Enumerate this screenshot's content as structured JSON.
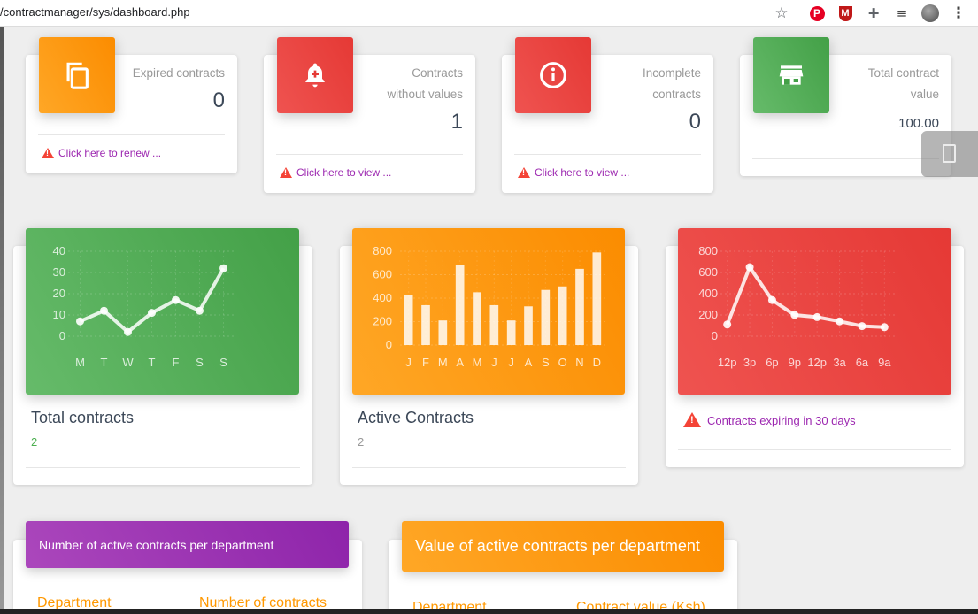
{
  "browser": {
    "url": "/contractmanager/sys/dashboard.php",
    "icons": [
      "star-icon",
      "pinterest-icon",
      "mcafee-icon",
      "extensions-icon",
      "media-queue-icon",
      "profile-avatar",
      "menu-dots-icon"
    ]
  },
  "stats": [
    {
      "label_lines": [
        "Expired contracts"
      ],
      "value": "0",
      "link": "Click here to renew ...",
      "icon": "copy-icon",
      "color": "#fb8c00"
    },
    {
      "label_lines": [
        "Contracts",
        "without values"
      ],
      "value": "1",
      "link": "Click here to view ...",
      "icon": "notification-add-icon",
      "color": "#e53935"
    },
    {
      "label_lines": [
        "Incomplete",
        "contracts"
      ],
      "value": "0",
      "link": "Click here to view ...",
      "icon": "info-icon",
      "color": "#e53935"
    },
    {
      "label_lines": [
        "Total contract",
        "value"
      ],
      "value": "100.00",
      "link": "",
      "icon": "store-icon",
      "color": "#43a047"
    }
  ],
  "charts": {
    "total": {
      "title": "Total contracts",
      "subtitle": "2",
      "chart_data": {
        "type": "line",
        "categories": [
          "M",
          "T",
          "W",
          "T",
          "F",
          "S",
          "S"
        ],
        "values": [
          7,
          12,
          2,
          11,
          17,
          12,
          32
        ],
        "ylim": [
          0,
          40
        ],
        "yticks": [
          0,
          10,
          20,
          30,
          40
        ],
        "color": "#ffffff"
      }
    },
    "active": {
      "title": "Active Contracts",
      "subtitle": "2",
      "chart_data": {
        "type": "bar",
        "categories": [
          "J",
          "F",
          "M",
          "A",
          "M",
          "J",
          "J",
          "A",
          "S",
          "O",
          "N",
          "D"
        ],
        "values": [
          430,
          340,
          210,
          680,
          450,
          340,
          210,
          330,
          470,
          500,
          650,
          790
        ],
        "ylim": [
          0,
          800
        ],
        "yticks": [
          0,
          200,
          400,
          600,
          800
        ],
        "color": "#ffffff"
      }
    },
    "expiring": {
      "title": "",
      "subtitle": "Contracts expiring in 30 days",
      "chart_data": {
        "type": "line",
        "categories": [
          "12p",
          "3p",
          "6p",
          "9p",
          "12p",
          "3a",
          "6a",
          "9a"
        ],
        "values": [
          110,
          650,
          340,
          200,
          180,
          140,
          95,
          85
        ],
        "ylim": [
          0,
          800
        ],
        "yticks": [
          0,
          200,
          400,
          600,
          800
        ],
        "color": "#ffffff"
      }
    }
  },
  "panels": {
    "count": {
      "title": "Number of active contracts per department",
      "col1": "Department",
      "col2": "Number of contracts"
    },
    "value": {
      "title": "Value of active contracts per department",
      "col1": "Department",
      "col2": "Contract value (Ksh)"
    }
  }
}
